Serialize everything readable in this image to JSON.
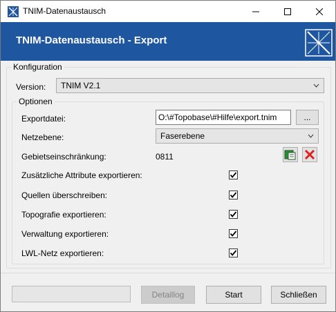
{
  "window": {
    "title": "TNIM-Datenaustausch",
    "minimize_icon": "minimize-icon",
    "maximize_icon": "maximize-icon",
    "close_icon": "close-icon"
  },
  "banner": {
    "title": "TNIM-Datenaustausch - Export",
    "background": "#1e56a0",
    "logo_icon": "tnim-logo-icon"
  },
  "config": {
    "legend": "Konfiguration",
    "version_label": "Version:",
    "version_value": "TNIM V2.1"
  },
  "options": {
    "legend": "Optionen",
    "export_file_label": "Exportdatei:",
    "export_file_value": "O:\\#Topobase\\#Hilfe\\export.tnim",
    "browse_label": "...",
    "network_label": "Netzebene:",
    "network_value": "Faserebene",
    "area_label": "Gebietseinschränkung:",
    "area_value": "0811",
    "area_edit_icon": "area-select-icon",
    "area_delete_icon": "delete-x-icon",
    "checkboxes": [
      {
        "label": "Zusätzliche Attribute exportieren:",
        "checked": true
      },
      {
        "label": "Quellen überschreiben:",
        "checked": true
      },
      {
        "label": "Topografie exportieren:",
        "checked": true
      },
      {
        "label": "Verwaltung exportieren:",
        "checked": true
      },
      {
        "label": "LWL-Netz exportieren:",
        "checked": true
      }
    ]
  },
  "footer": {
    "progress": 0,
    "detaillog_label": "Detaillog",
    "start_label": "Start",
    "close_label": "Schließen"
  }
}
